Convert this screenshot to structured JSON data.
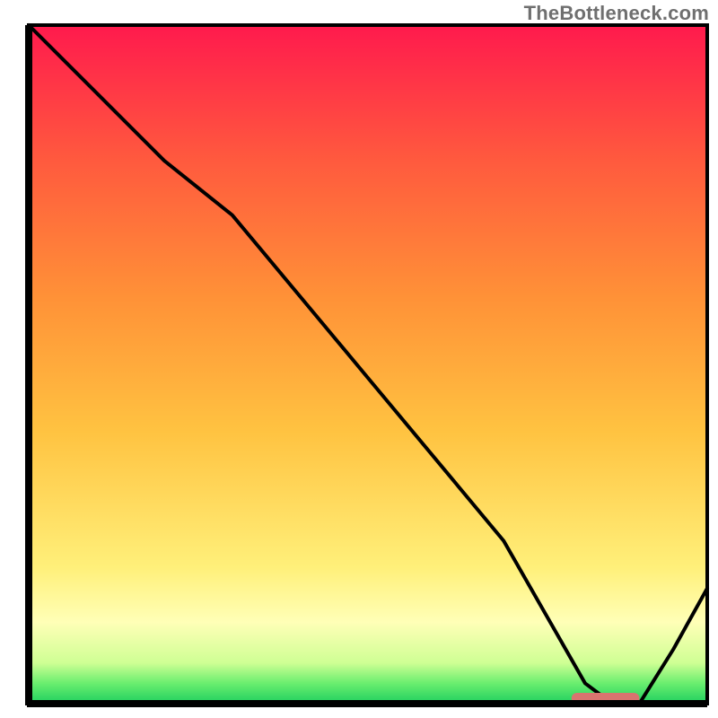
{
  "watermark": "TheBottleneck.com",
  "chart_data": {
    "type": "line",
    "title": "",
    "xlabel": "",
    "ylabel": "",
    "xlim": [
      0,
      100
    ],
    "ylim": [
      0,
      100
    ],
    "x": [
      0,
      5,
      10,
      20,
      30,
      40,
      50,
      60,
      70,
      78,
      82,
      86,
      90,
      95,
      100
    ],
    "values": [
      100,
      95,
      90,
      80,
      72,
      60,
      48,
      36,
      24,
      10,
      3,
      0,
      0,
      8,
      17
    ],
    "optimal_range": {
      "start": 80,
      "end": 90
    },
    "gradient_stops": [
      {
        "pct": 0,
        "color": "#1fcf5f"
      },
      {
        "pct": 3,
        "color": "#6aee6f"
      },
      {
        "pct": 6,
        "color": "#cfff94"
      },
      {
        "pct": 12,
        "color": "#ffffb7"
      },
      {
        "pct": 20,
        "color": "#fff07a"
      },
      {
        "pct": 40,
        "color": "#ffc341"
      },
      {
        "pct": 60,
        "color": "#ff9137"
      },
      {
        "pct": 80,
        "color": "#ff5a3e"
      },
      {
        "pct": 100,
        "color": "#ff1a4d"
      }
    ],
    "marker_color": "#d9746f"
  }
}
